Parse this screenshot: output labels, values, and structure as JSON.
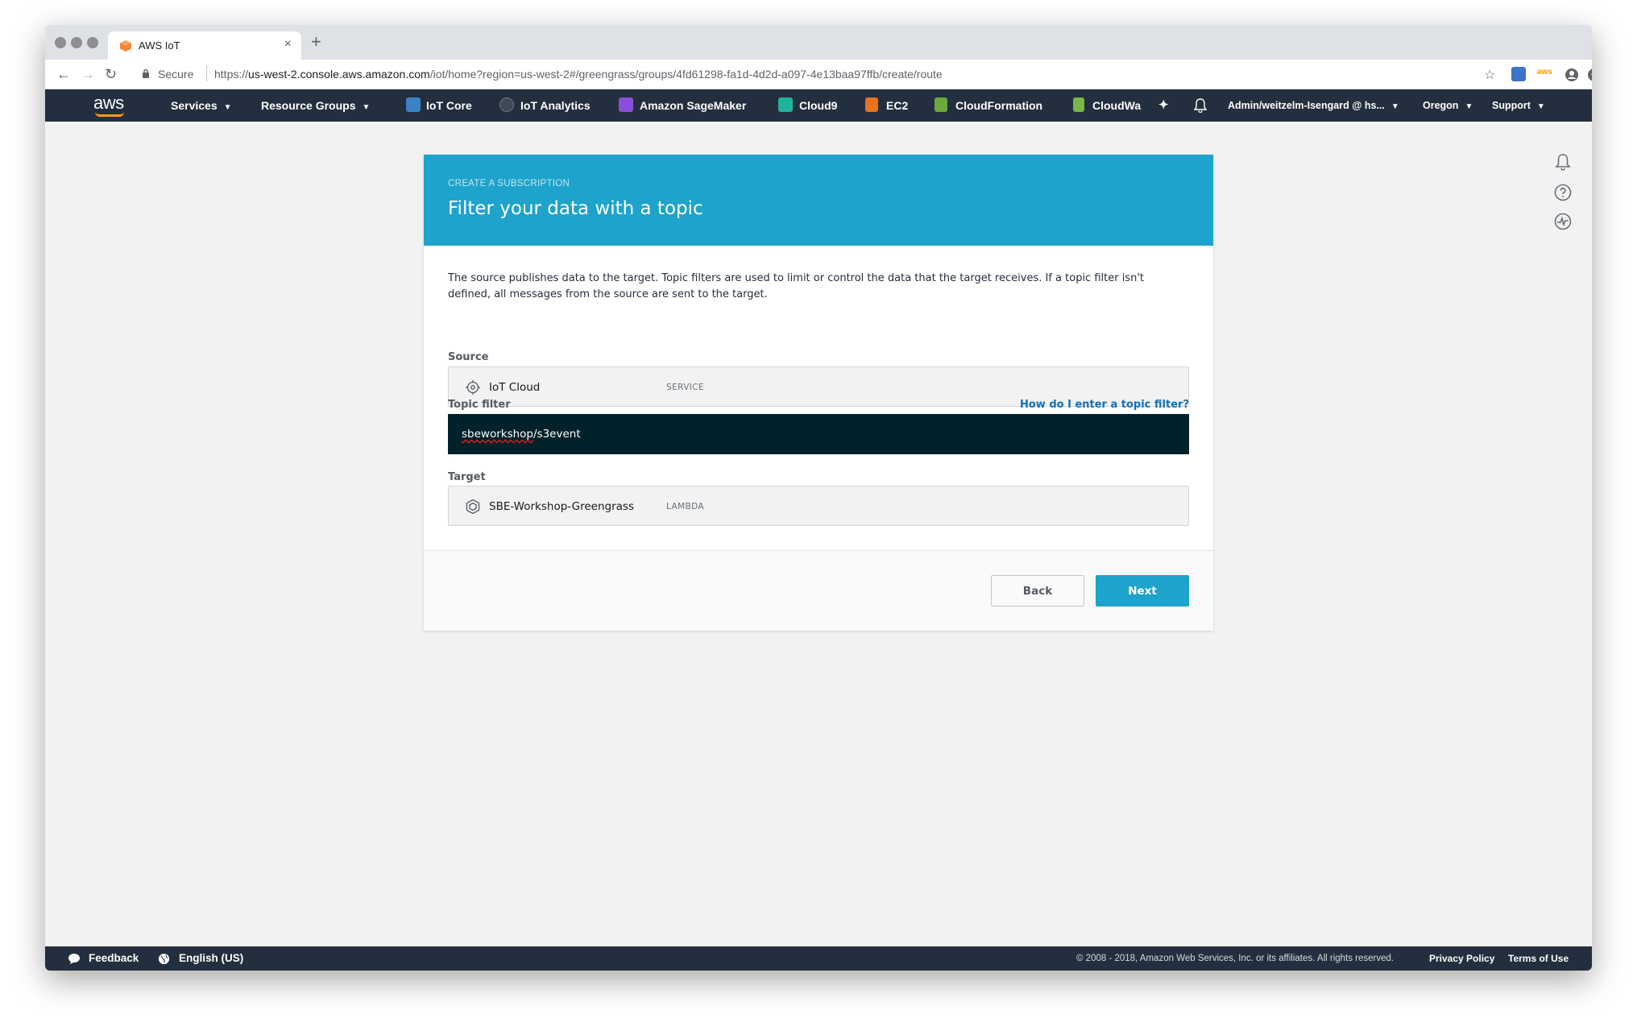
{
  "browser": {
    "tab_title": "AWS IoT",
    "tab_close": "×",
    "new_tab": "+",
    "secure_label": "Secure",
    "url_scheme": "https://",
    "url_host": "us-west-2.console.aws.amazon.com",
    "url_path": "/iot/home?region=us-west-2#/greengrass/groups/4fd61298-fa1d-4d2d-a097-4e13baa97ffb/create/route"
  },
  "awsnav": {
    "logo": "aws",
    "services": "Services",
    "resource_groups": "Resource Groups",
    "shortcuts": [
      {
        "label": "IoT Core",
        "color": "#3b82c4"
      },
      {
        "label": "IoT Analytics",
        "color": "#6b7580"
      },
      {
        "label": "Amazon SageMaker",
        "color": "#8a4fd8"
      },
      {
        "label": "Cloud9",
        "color": "#1fb39c"
      },
      {
        "label": "EC2",
        "color": "#e8731c"
      },
      {
        "label": "CloudFormation",
        "color": "#6aa93b"
      },
      {
        "label": "CloudWa",
        "color": "#7ab54a"
      }
    ],
    "account": "Admin/weitzelm-Isengard @ hs...",
    "region": "Oregon",
    "support": "Support"
  },
  "card": {
    "eyebrow": "CREATE A SUBSCRIPTION",
    "title": "Filter your data with a topic",
    "description": "The source publishes data to the target. Topic filters are used to limit or control the data that the target receives. If a topic filter isn't defined, all messages from the source are sent to the target.",
    "source_label": "Source",
    "source_name": "IoT Cloud",
    "source_type": "SERVICE",
    "topic_label": "Topic filter",
    "topic_help": "How do I enter a topic filter?",
    "topic_value_word": "sbeworkshop",
    "topic_value_rest": "/s3event",
    "target_label": "Target",
    "target_name": "SBE-Workshop-Greengrass",
    "target_type": "LAMBDA",
    "back_label": "Back",
    "next_label": "Next"
  },
  "footer": {
    "feedback": "Feedback",
    "language": "English (US)",
    "copyright": "© 2008 - 2018, Amazon Web Services, Inc. or its affiliates. All rights reserved.",
    "privacy": "Privacy Policy",
    "terms": "Terms of Use"
  },
  "colors": {
    "header_blue": "#1ea3cc",
    "nav_dark": "#232f3e",
    "input_dark": "#02222b",
    "link_blue": "#1170b9",
    "aws_orange": "#ff9900"
  }
}
